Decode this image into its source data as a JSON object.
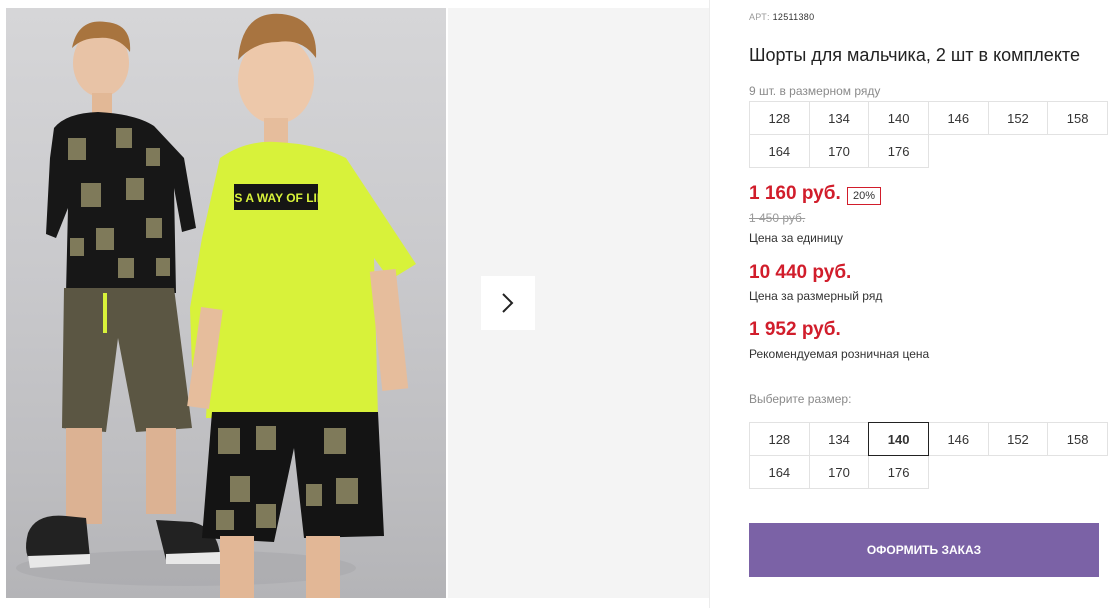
{
  "product": {
    "article_label": "АРТ:",
    "article_number": "12511380",
    "title": "Шорты для мальчика, 2 шт в комплекте"
  },
  "gallery": {
    "next_icon": "chevron-right-icon",
    "tshirt_print": "IT`S A WAY OF LIFE"
  },
  "size_row": {
    "note": "9 шт. в размерном ряду",
    "sizes": [
      "128",
      "134",
      "140",
      "146",
      "152",
      "158",
      "164",
      "170",
      "176"
    ]
  },
  "prices": {
    "unit_price": "1 160 руб.",
    "discount": "20%",
    "old_price": "1 450 руб.",
    "unit_caption": "Цена за единицу",
    "row_price": "10 440 руб.",
    "row_caption": "Цена за размерный ряд",
    "retail_price": "1 952 руб.",
    "retail_caption": "Рекомендуемая розничная цена"
  },
  "size_select": {
    "label": "Выберите размер:",
    "sizes": [
      "128",
      "134",
      "140",
      "146",
      "152",
      "158",
      "164",
      "170",
      "176"
    ],
    "selected": "140"
  },
  "order_button": {
    "label": "ОФОРМИТЬ ЗАКАЗ"
  },
  "colors": {
    "price": "#d11d2b",
    "button": "#7b62a6",
    "tshirt": "#d8f23a"
  }
}
